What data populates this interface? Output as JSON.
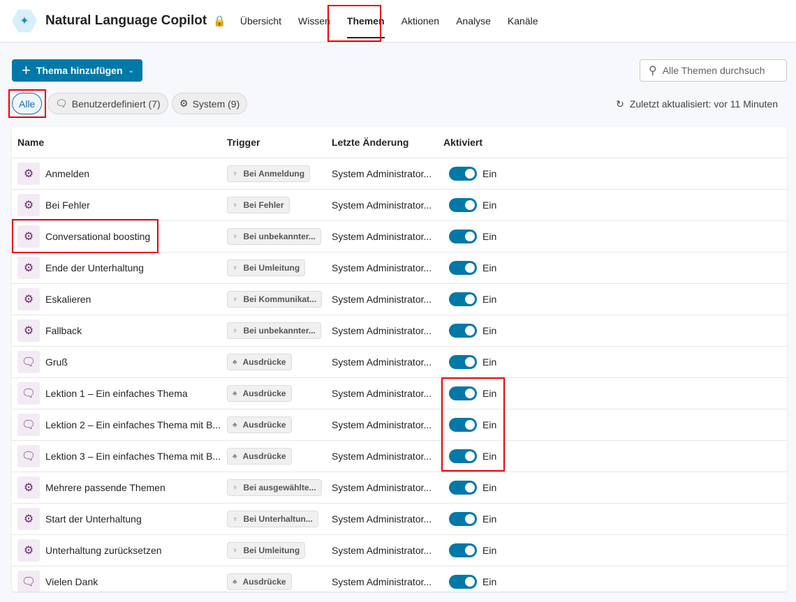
{
  "app": {
    "title": "Natural Language Copilot"
  },
  "nav": [
    "Übersicht",
    "Wissen",
    "Themen",
    "Aktionen",
    "Analyse",
    "Kanäle"
  ],
  "toolbar": {
    "add_label": "Thema hinzufügen",
    "search_placeholder": "Alle Themen durchsuch"
  },
  "filters": [
    "Alle",
    "Benutzerdefiniert (7)",
    "System (9)"
  ],
  "updated": "Zuletzt aktualisiert: vor 11 Minuten",
  "columns": [
    "Name",
    "Trigger",
    "Letzte Änderung",
    "Aktiviert"
  ],
  "rows": [
    {
      "name": "Anmelden",
      "type": "system",
      "trigger": "Bei Anmeldung",
      "modified": "System Administrator...",
      "status": "Ein"
    },
    {
      "name": "Bei Fehler",
      "type": "system",
      "trigger": "Bei Fehler",
      "modified": "System Administrator...",
      "status": "Ein"
    },
    {
      "name": "Conversational boosting",
      "type": "system",
      "trigger": "Bei unbekannter...",
      "modified": "System Administrator...",
      "status": "Ein"
    },
    {
      "name": "Ende der Unterhaltung",
      "type": "system",
      "trigger": "Bei Umleitung",
      "modified": "System Administrator...",
      "status": "Ein"
    },
    {
      "name": "Eskalieren",
      "type": "system",
      "trigger": "Bei Kommunikat...",
      "modified": "System Administrator...",
      "status": "Ein"
    },
    {
      "name": "Fallback",
      "type": "system",
      "trigger": "Bei unbekannter...",
      "modified": "System Administrator...",
      "status": "Ein"
    },
    {
      "name": "Gruß",
      "type": "custom",
      "trigger": "Ausdrücke",
      "modified": "System Administrator...",
      "status": "Ein"
    },
    {
      "name": "Lektion 1 – Ein einfaches Thema",
      "type": "custom",
      "trigger": "Ausdrücke",
      "modified": "System Administrator...",
      "status": "Ein"
    },
    {
      "name": "Lektion 2 – Ein einfaches Thema mit B...",
      "type": "custom",
      "trigger": "Ausdrücke",
      "modified": "System Administrator...",
      "status": "Ein"
    },
    {
      "name": "Lektion 3 – Ein einfaches Thema mit B...",
      "type": "custom",
      "trigger": "Ausdrücke",
      "modified": "System Administrator...",
      "status": "Ein"
    },
    {
      "name": "Mehrere passende Themen",
      "type": "system",
      "trigger": "Bei ausgewählte...",
      "modified": "System Administrator...",
      "status": "Ein"
    },
    {
      "name": "Start der Unterhaltung",
      "type": "system",
      "trigger": "Bei Unterhaltun...",
      "modified": "System Administrator...",
      "status": "Ein"
    },
    {
      "name": "Unterhaltung zurücksetzen",
      "type": "system",
      "trigger": "Bei Umleitung",
      "modified": "System Administrator...",
      "status": "Ein"
    },
    {
      "name": "Vielen Dank",
      "type": "custom",
      "trigger": "Ausdrücke",
      "modified": "System Administrator...",
      "status": "Ein"
    }
  ]
}
